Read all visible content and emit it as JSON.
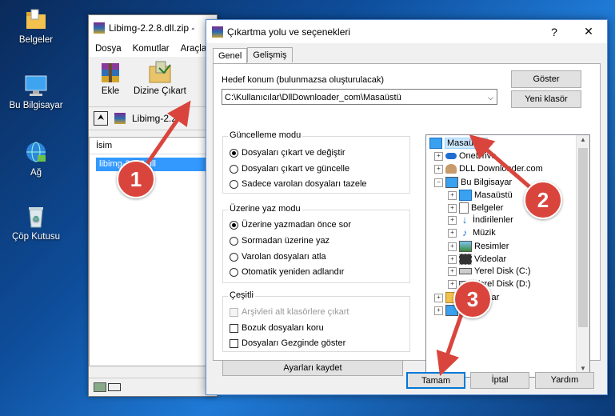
{
  "desktop": {
    "icons": [
      {
        "label": "Belgeler",
        "icon": "folder-icon"
      },
      {
        "label": "Bu Bilgisayar",
        "icon": "computer-icon"
      },
      {
        "label": "Ağ",
        "icon": "network-icon"
      },
      {
        "label": "Çöp Kutusu",
        "icon": "recycle-bin-icon"
      }
    ]
  },
  "winrar": {
    "title": "Libimg-2.2.8.dll.zip -",
    "menu": [
      "Dosya",
      "Komutlar",
      "Araçla"
    ],
    "tools": {
      "add": "Ekle",
      "extract": "Dizine Çıkart"
    },
    "address": "Libimg-2.2.",
    "column_name": "İsim",
    "file": "libimg-2.2.8.dll"
  },
  "dialog": {
    "title": "Çıkartma yolu ve seçenekleri",
    "help_btn": "?",
    "close_btn": "✕",
    "tabs": [
      "Genel",
      "Gelişmiş"
    ],
    "dest_label": "Hedef konum (bulunmazsa oluşturulacak)",
    "dest_value": "C:\\Kullanıcılar\\DllDownloader_com\\Masaüstü",
    "show_btn": "Göster",
    "new_folder_btn": "Yeni klasör",
    "update_mode": {
      "title": "Güncelleme modu",
      "options": [
        "Dosyaları çıkart ve değiştir",
        "Dosyaları çıkart ve güncelle",
        "Sadece varolan dosyaları tazele"
      ],
      "selected": 0
    },
    "overwrite_mode": {
      "title": "Üzerine yaz modu",
      "options": [
        "Üzerine yazmadan önce sor",
        "Sormadan üzerine yaz",
        "Varolan dosyaları atla",
        "Otomatik yeniden adlandır"
      ],
      "selected": 0
    },
    "misc": {
      "title": "Çeşitli",
      "options": [
        "Arşivleri alt klasörlere çıkart",
        "Bozuk dosyaları koru",
        "Dosyaları Gezginde göster"
      ],
      "disabled": [
        true,
        false,
        false
      ]
    },
    "save_settings_btn": "Ayarları kaydet",
    "tree": [
      {
        "label": "Masaüstü",
        "level": 0,
        "icon": "desktop-icon",
        "selected": true
      },
      {
        "label": "OneDrive",
        "level": 1,
        "icon": "cloud-icon"
      },
      {
        "label": "DLL Downloader.com",
        "level": 1,
        "icon": "user-icon"
      },
      {
        "label": "Bu Bilgisayar",
        "level": 1,
        "icon": "computer-icon",
        "expanded": true
      },
      {
        "label": "Masaüstü",
        "level": 2,
        "icon": "desktop-icon"
      },
      {
        "label": "Belgeler",
        "level": 2,
        "icon": "document-icon"
      },
      {
        "label": "İndirilenler",
        "level": 2,
        "icon": "download-icon"
      },
      {
        "label": "Müzik",
        "level": 2,
        "icon": "music-icon"
      },
      {
        "label": "Resimler",
        "level": 2,
        "icon": "pictures-icon"
      },
      {
        "label": "Videolar",
        "level": 2,
        "icon": "video-icon"
      },
      {
        "label": "Yerel Disk (C:)",
        "level": 2,
        "icon": "drive-icon"
      },
      {
        "label": "Yerel Disk (D:)",
        "level": 2,
        "icon": "drive-icon"
      },
      {
        "label": "Kitaplıklar",
        "level": 1,
        "icon": "library-icon"
      },
      {
        "label": "",
        "level": 1,
        "icon": "network-icon"
      }
    ],
    "buttons": {
      "ok": "Tamam",
      "cancel": "İptal",
      "help": "Yardım"
    }
  },
  "annotations": [
    "1",
    "2",
    "3"
  ],
  "colors": {
    "annotation": "#d9453d",
    "selection": "#3399ff"
  }
}
